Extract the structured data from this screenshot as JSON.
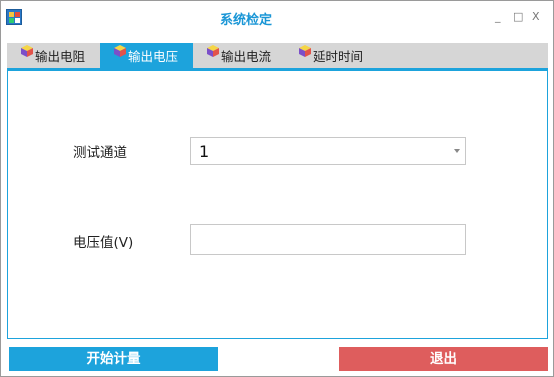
{
  "window": {
    "title": "系统检定",
    "minimize_glyph": "_",
    "maximize_glyph": "□",
    "close_glyph": "X"
  },
  "tabs": [
    {
      "label": "输出电阻",
      "icon": "cube-icon",
      "active": false
    },
    {
      "label": "输出电压",
      "icon": "cube-icon",
      "active": true
    },
    {
      "label": "输出电流",
      "icon": "cube-icon",
      "active": false
    },
    {
      "label": "延时时间",
      "icon": "cube-icon",
      "active": false
    }
  ],
  "form": {
    "channel_label": "测试通道",
    "channel_value": "1",
    "voltage_label": "电压值(V)",
    "voltage_value": ""
  },
  "buttons": {
    "start_label": "开始计量",
    "exit_label": "退出"
  },
  "colors": {
    "accent": "#1da3dc",
    "title_text": "#1a96d6",
    "tabstrip_bg": "#d6d6d6",
    "exit_button": "#de5d5d"
  }
}
